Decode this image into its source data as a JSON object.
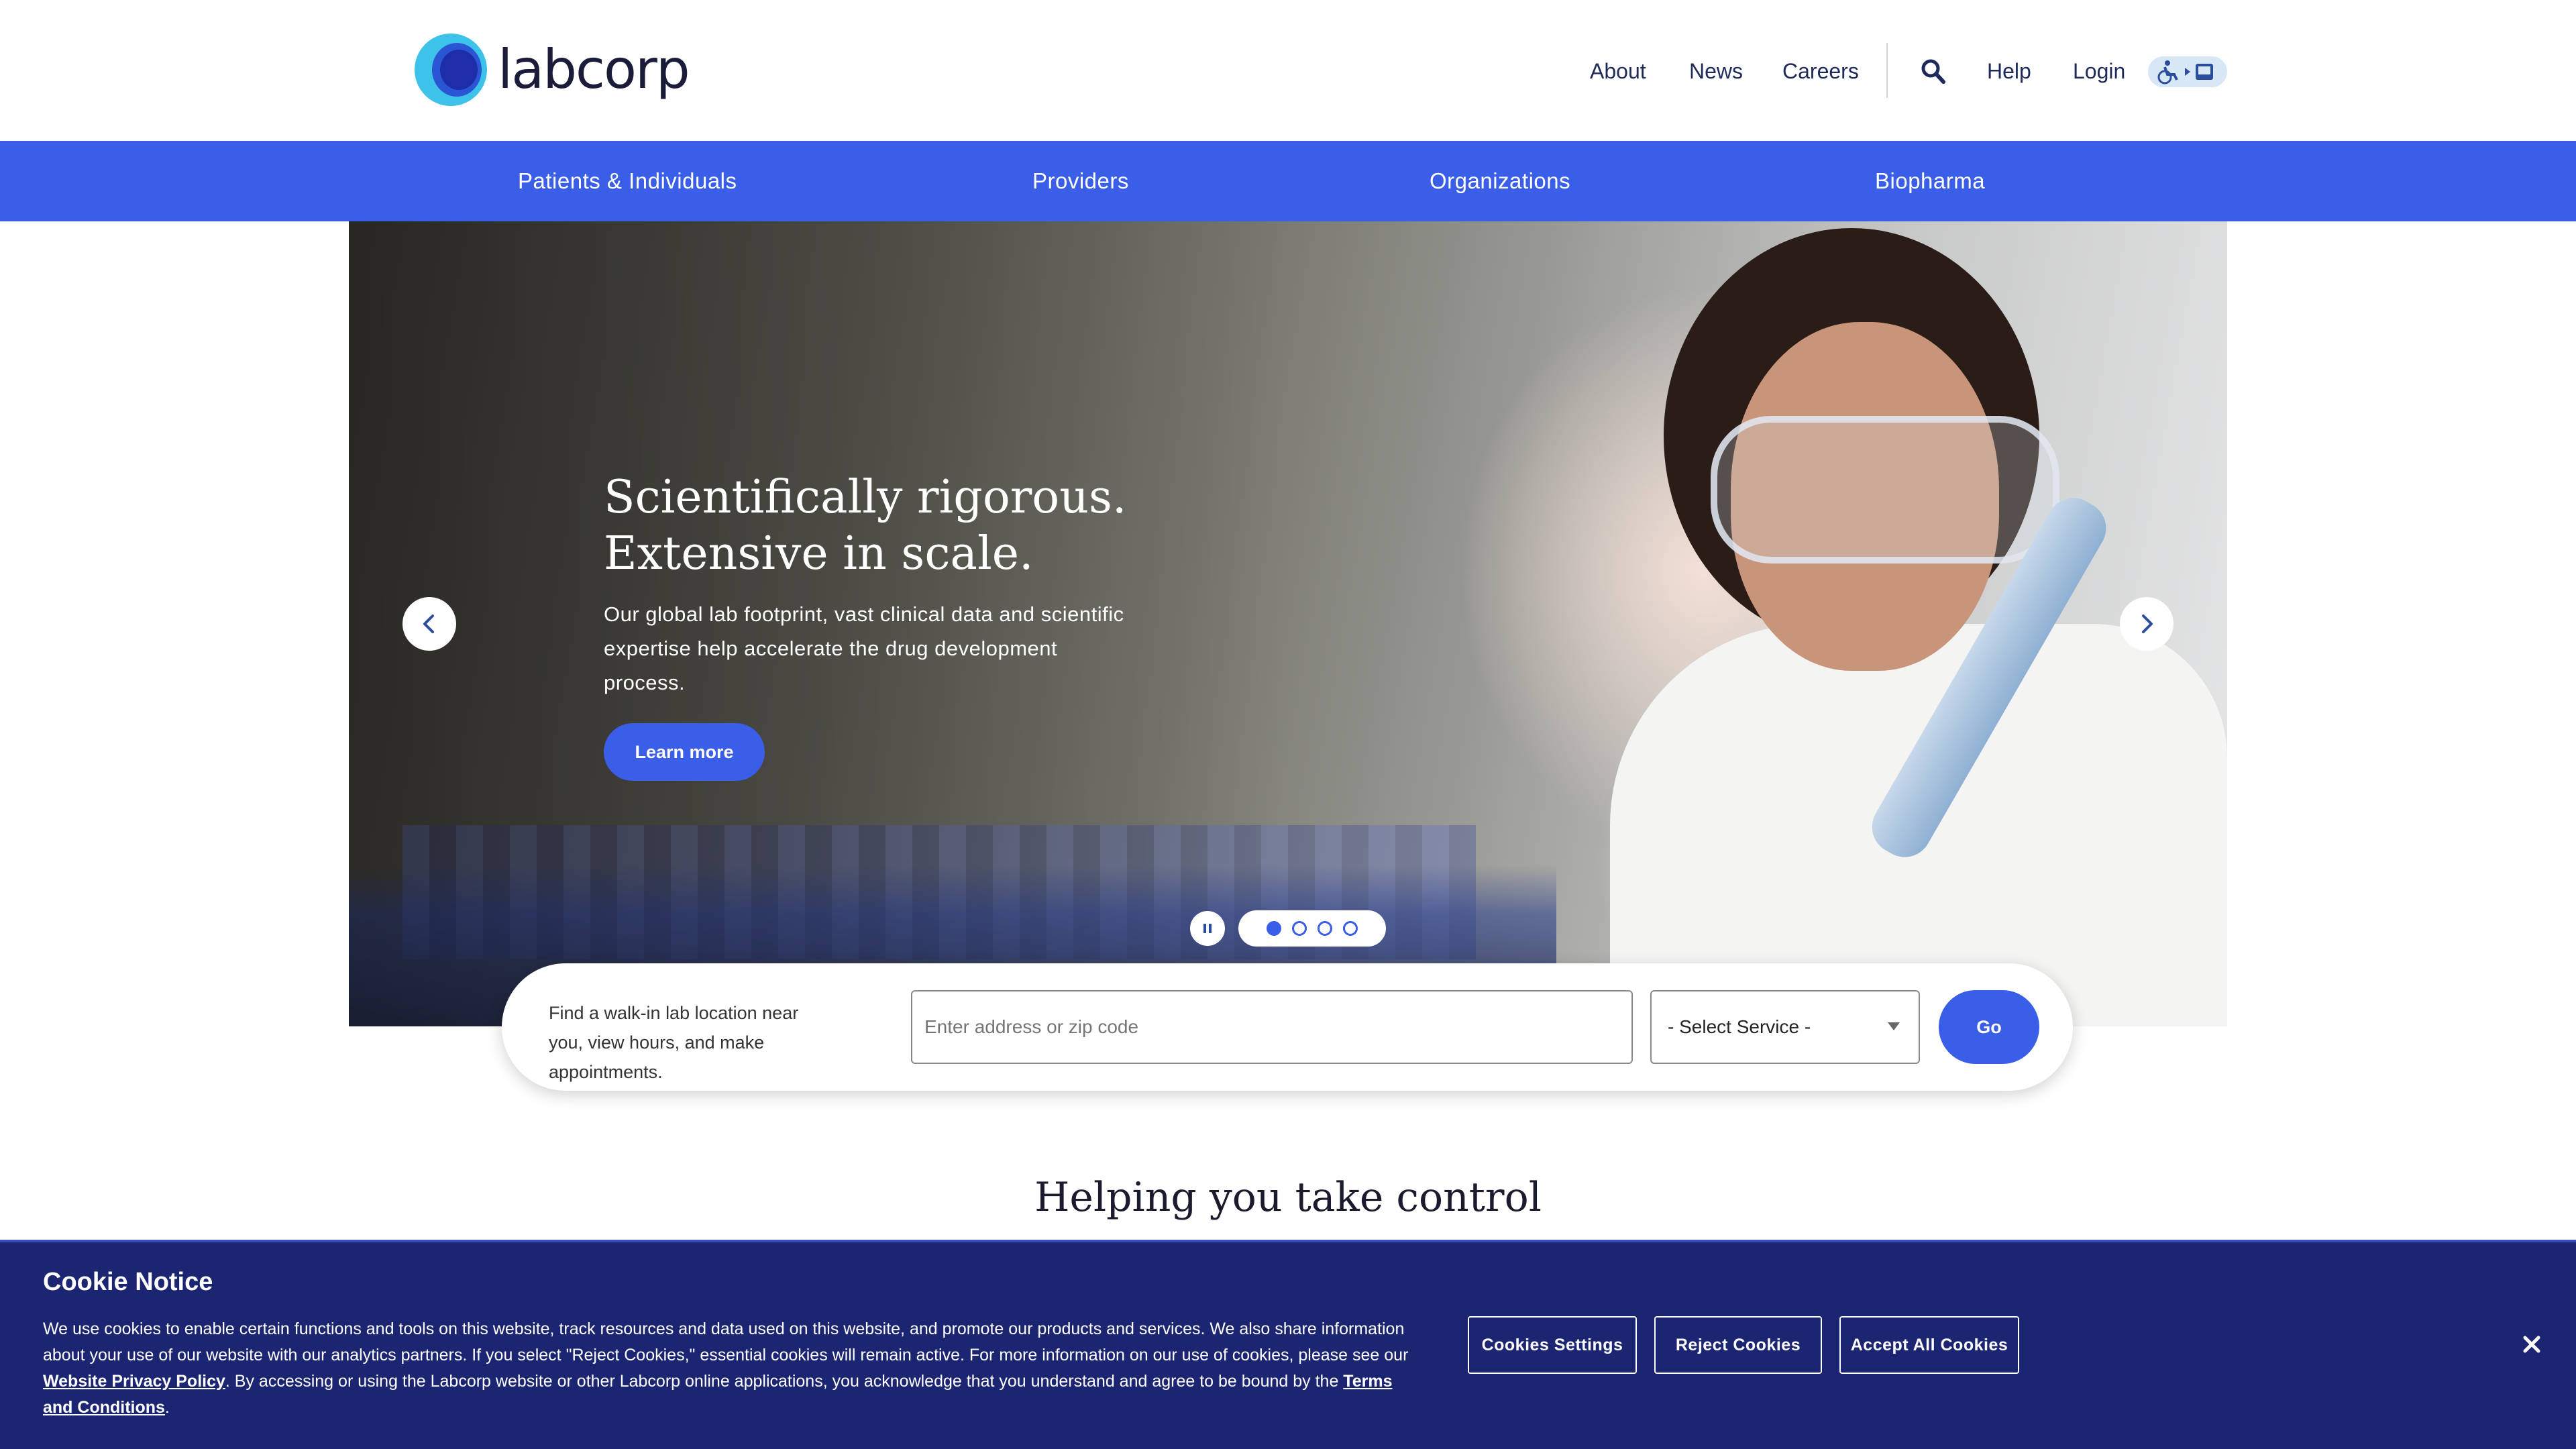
{
  "brand": {
    "name": "labcorp"
  },
  "utility_nav": {
    "about": "About",
    "news": "News",
    "careers": "Careers",
    "help": "Help",
    "login": "Login"
  },
  "main_nav": [
    "Patients & Individuals",
    "Providers",
    "Organizations",
    "Biopharma"
  ],
  "hero": {
    "title_line1": "Scientifically rigorous.",
    "title_line2": "Extensive in scale.",
    "description": "Our global lab footprint, vast clinical data and scientific expertise help accelerate the drug development process.",
    "cta": "Learn more",
    "slide_count": 4,
    "active_slide": 1
  },
  "locator": {
    "text": "Find a walk-in lab location near you, view hours, and make appointments.",
    "address_placeholder": "Enter address or zip code",
    "service_selected": "- Select Service -",
    "go": "Go"
  },
  "section": {
    "title": "Helping you take control"
  },
  "cookie": {
    "title": "Cookie Notice",
    "body_part1": "We use cookies to enable certain functions and tools on this website, track resources and data used on this website, and promote our products and services. We also share information about your use of our website with our analytics partners. If you select \"Reject Cookies,\" essential cookies will remain active. For more information on our use of cookies, please see our ",
    "privacy_link": "Website Privacy Policy",
    "body_part2": ". By accessing or using the Labcorp website or other Labcorp online applications, you acknowledge that you understand and agree to be bound by the ",
    "terms_link": "Terms and Conditions",
    "body_part3": ".",
    "settings": "Cookies Settings",
    "reject": "Reject Cookies",
    "accept": "Accept All Cookies"
  },
  "colors": {
    "brand_blue": "#3a5ee8",
    "cookie_bg": "#1c2572",
    "logo_cyan": "#3dc3ea"
  },
  "icons": [
    "search-icon",
    "accessibility-icon",
    "chevron-left-icon",
    "chevron-right-icon",
    "pause-icon",
    "close-icon",
    "caret-down-icon"
  ]
}
